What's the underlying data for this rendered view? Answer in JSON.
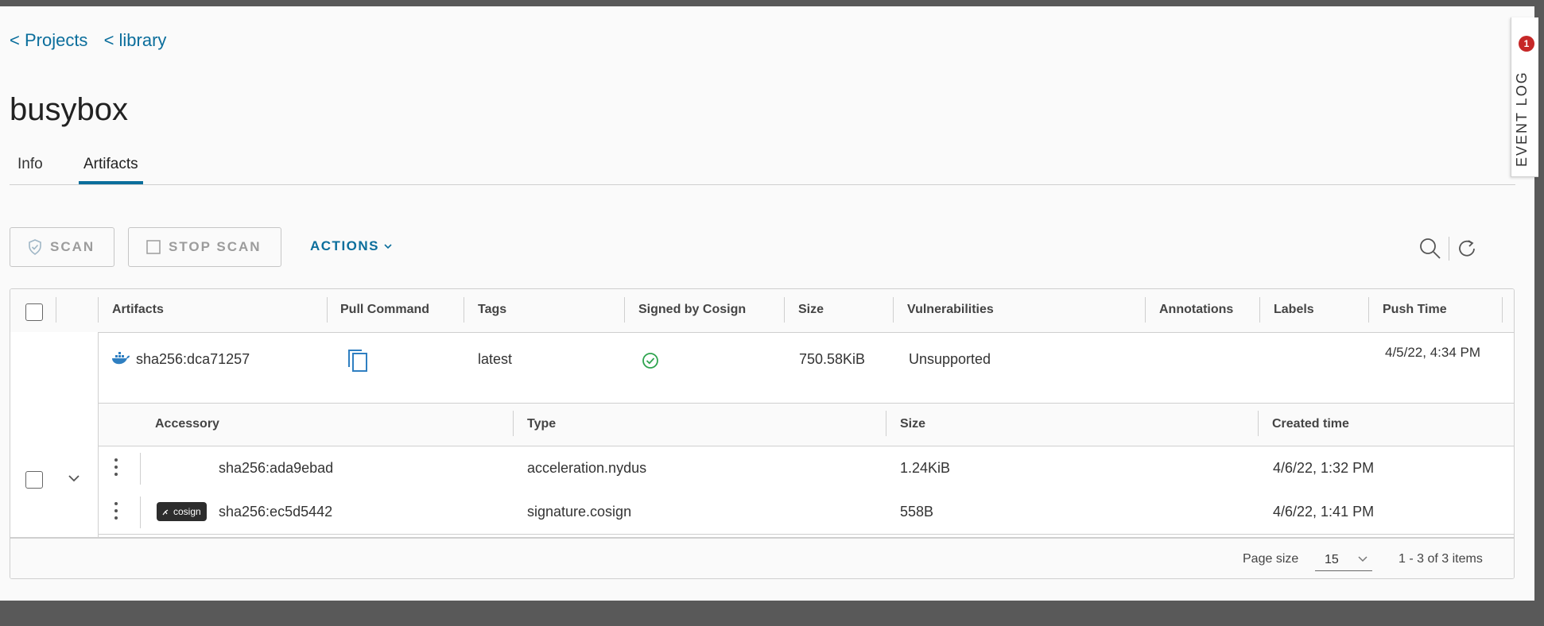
{
  "breadcrumbs": [
    "< Projects",
    "< library"
  ],
  "page_title": "busybox",
  "tabs": [
    {
      "label": "Info"
    },
    {
      "label": "Artifacts"
    }
  ],
  "toolbar": {
    "scan_label": "SCAN",
    "stop_scan_label": "STOP SCAN",
    "actions_label": "ACTIONS"
  },
  "table": {
    "columns": [
      "Artifacts",
      "Pull Command",
      "Tags",
      "Signed by Cosign",
      "Size",
      "Vulnerabilities",
      "Annotations",
      "Labels",
      "Push Time"
    ],
    "rows": [
      {
        "artifact": "sha256:dca71257",
        "tags": "latest",
        "size": "750.58KiB",
        "vulnerabilities": "Unsupported",
        "push_time": "4/5/22, 4:34 PM"
      }
    ],
    "accessory_columns": [
      "Accessory",
      "Type",
      "Size",
      "Created time"
    ],
    "accessories": [
      {
        "digest": "sha256:ada9ebad",
        "type": "acceleration.nydus",
        "size": "1.24KiB",
        "created": "4/6/22, 1:32 PM",
        "badge": ""
      },
      {
        "digest": "sha256:ec5d5442",
        "type": "signature.cosign",
        "size": "558B",
        "created": "4/6/22, 1:41 PM",
        "badge": "cosign"
      }
    ]
  },
  "footer": {
    "page_size_label": "Page size",
    "page_size_value": "15",
    "item_count": "1 - 3 of 3 items"
  },
  "event_log": {
    "label": "EVENT LOG",
    "badge": "1"
  },
  "colors": {
    "accent": "#0b6e9c",
    "success": "#2fa44f",
    "badge": "#c62828"
  }
}
